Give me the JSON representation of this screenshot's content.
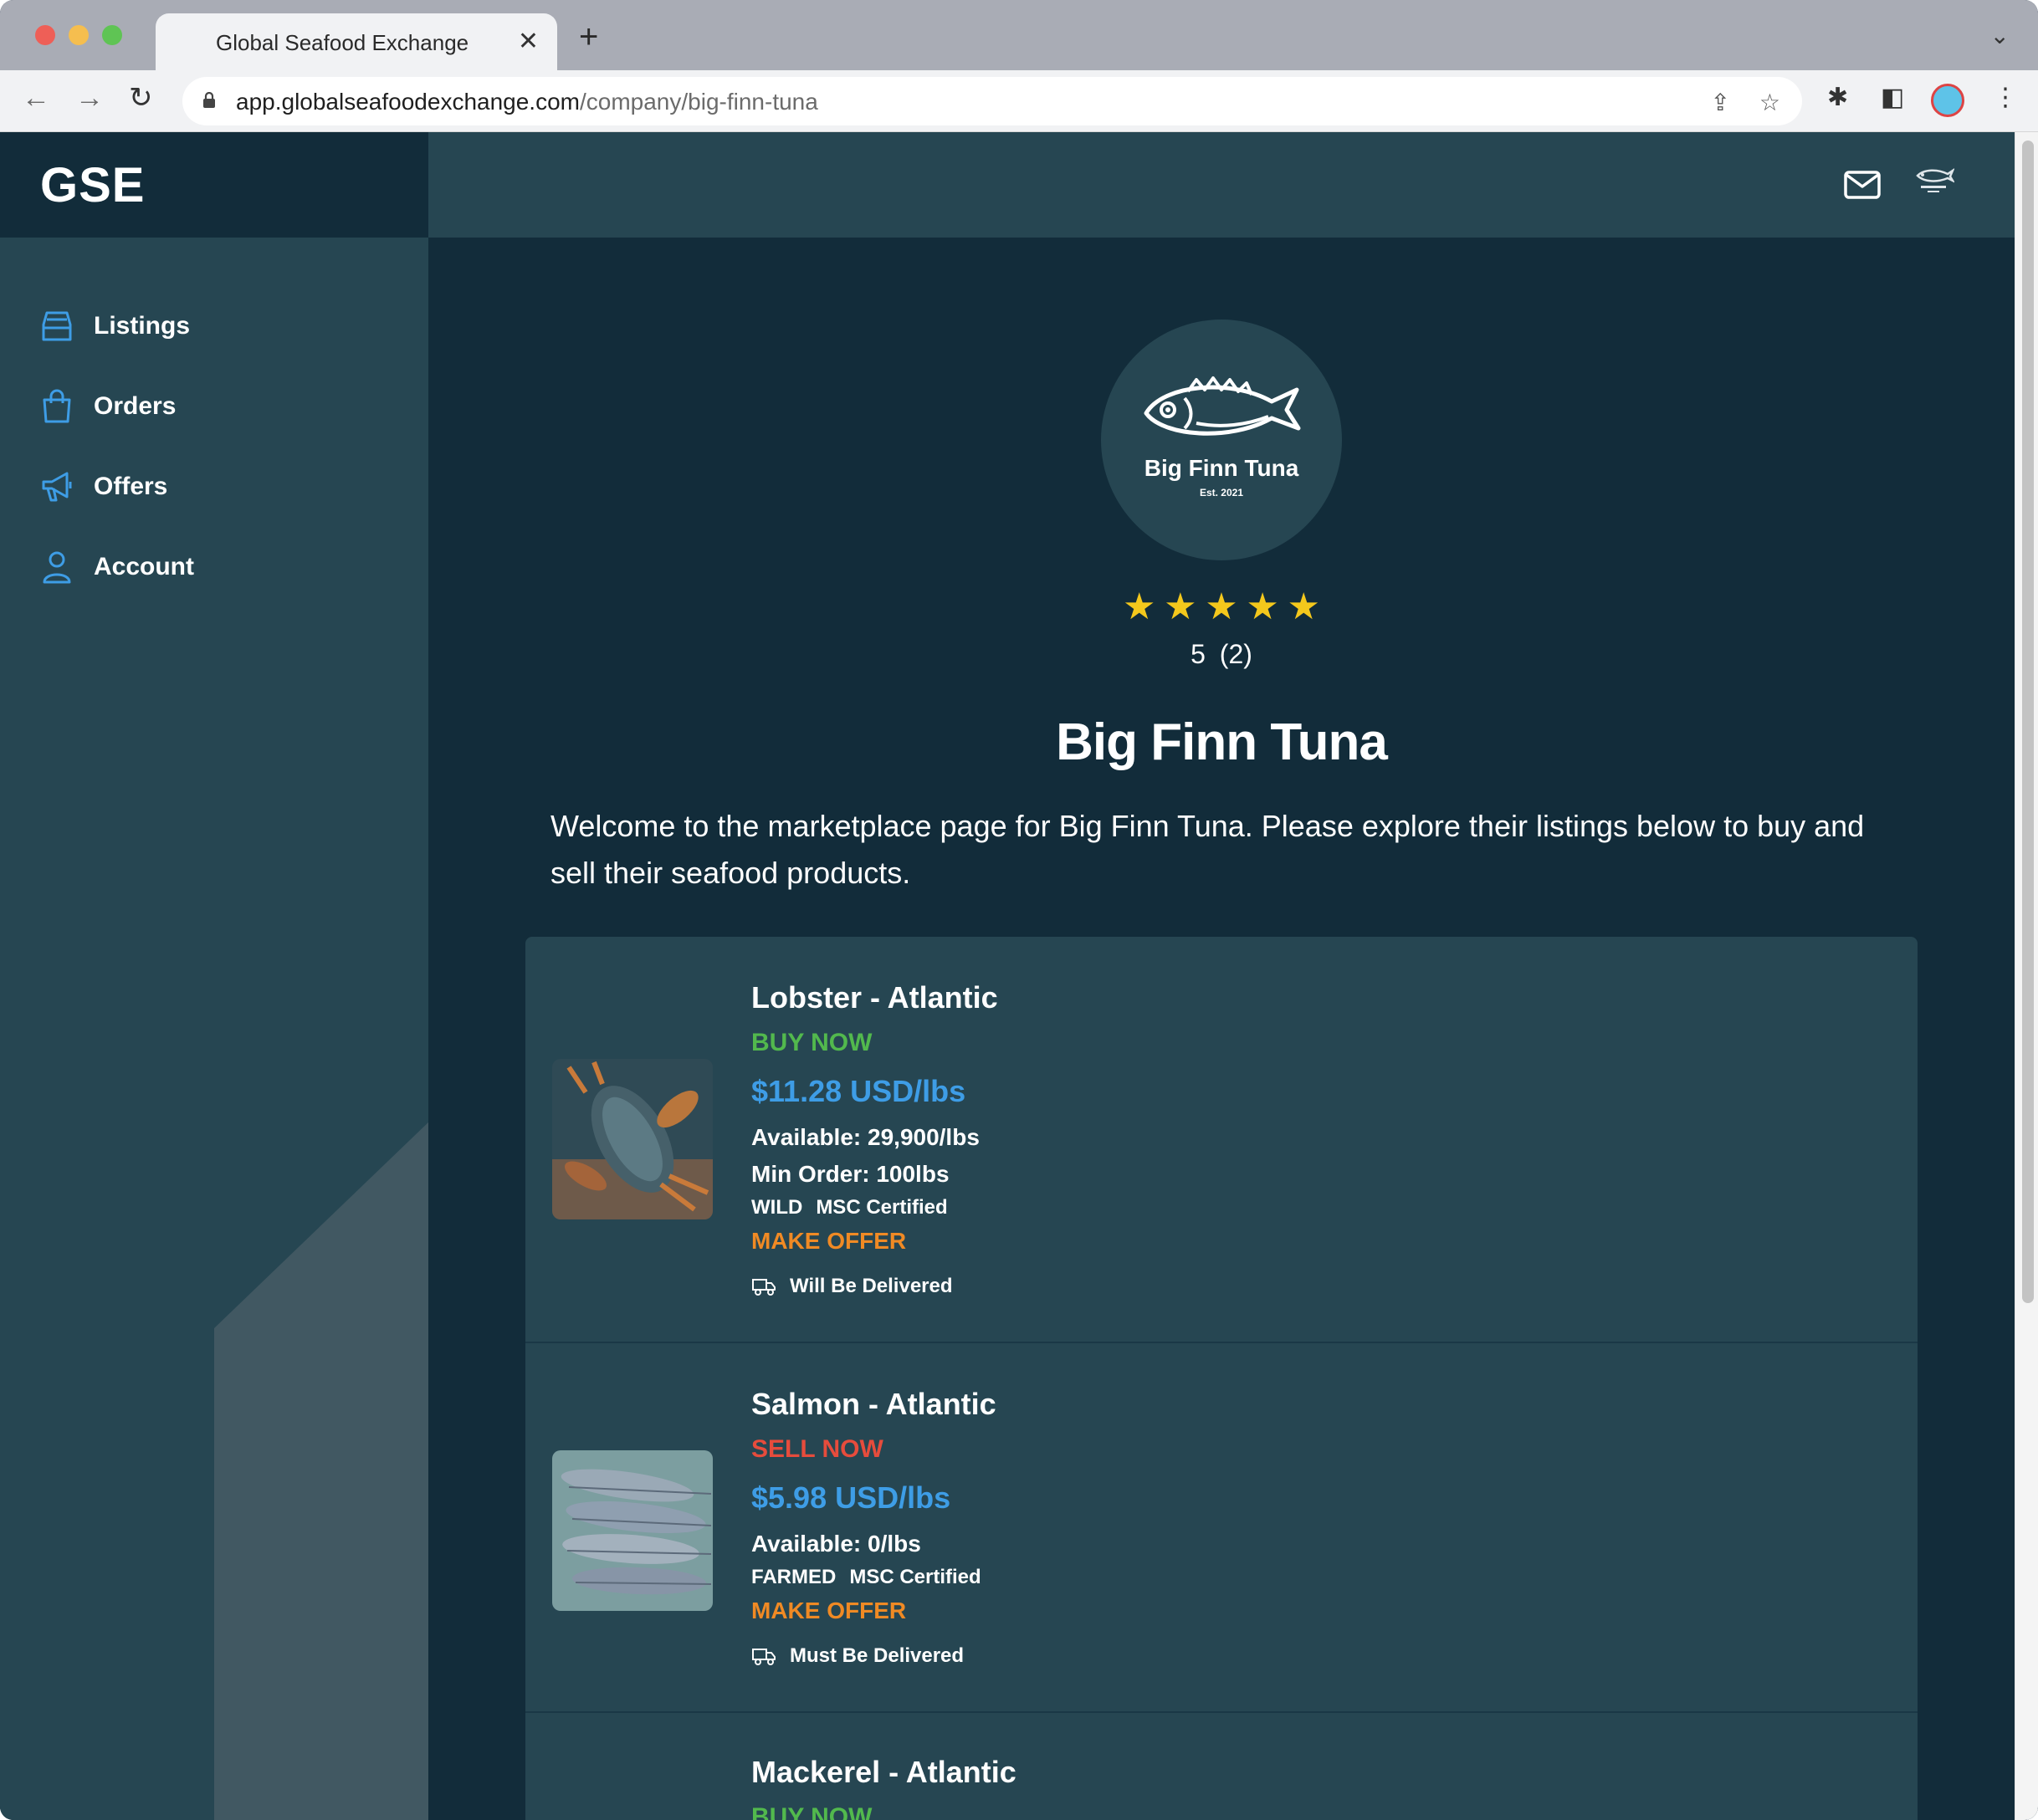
{
  "browser": {
    "tab_title": "Global Seafood Exchange",
    "tab_close": "✕",
    "new_tab": "+",
    "url_host": "app.globalseafoodexchange.com",
    "url_path": "/company/big-finn-tuna"
  },
  "sidebar": {
    "brand": "GSE",
    "items": [
      {
        "label": "Listings",
        "icon": "tray-icon"
      },
      {
        "label": "Orders",
        "icon": "shopping-bag-icon"
      },
      {
        "label": "Offers",
        "icon": "megaphone-icon"
      },
      {
        "label": "Account",
        "icon": "user-icon"
      }
    ]
  },
  "header": {
    "icons": [
      "mail-icon",
      "company-logo-icon"
    ]
  },
  "company": {
    "logo_name": "Big Finn Tuna",
    "logo_est": "Est. 2021",
    "rating_stars": 5,
    "rating_value": "5",
    "rating_count": "(2)",
    "name": "Big Finn Tuna",
    "description": "Welcome to the marketplace page for Big Finn Tuna. Please explore their listings below to buy and sell their seafood products."
  },
  "listings": [
    {
      "title": "Lobster - Atlantic",
      "action": "BUY NOW",
      "price": "$11.28 USD/lbs",
      "available": "Available: 29,900/lbs",
      "min_order": "Min Order: 100lbs",
      "tags": [
        "WILD",
        "MSC Certified"
      ],
      "offer": "MAKE OFFER",
      "delivery": "Will Be Delivered"
    },
    {
      "title": "Salmon - Atlantic",
      "action": "SELL NOW",
      "price": "$5.98 USD/lbs",
      "available": "Available: 0/lbs",
      "tags": [
        "FARMED",
        "MSC Certified"
      ],
      "offer": "MAKE OFFER",
      "delivery": "Must Be Delivered"
    },
    {
      "title": "Mackerel - Atlantic",
      "action": "BUY NOW"
    }
  ],
  "colors": {
    "sidebar_bg": "#264652",
    "content_bg": "#122c3a",
    "buy": "#52b94d",
    "sell": "#e74c3c",
    "price": "#3e9de6",
    "offer": "#f08a24",
    "star": "#f4c81c",
    "icon_accent": "#3e9de6"
  }
}
